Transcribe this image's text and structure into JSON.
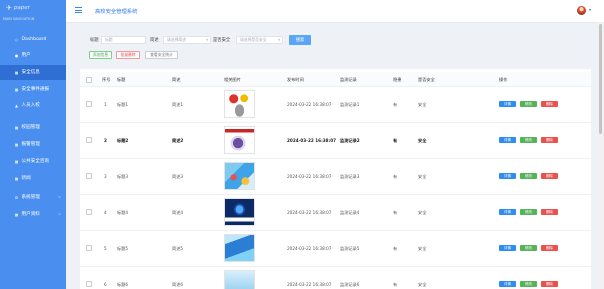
{
  "app": {
    "logo_text": "paper",
    "title": "高校安全管理系统"
  },
  "sidebar": {
    "nav_label": "MAIN NAVIGATION",
    "items": [
      {
        "label": "Dashboard",
        "icon": "dashboard-icon"
      },
      {
        "label": "用户",
        "icon": "user-icon"
      },
      {
        "label": "安全信息",
        "icon": "grid-icon",
        "active": true
      },
      {
        "label": "安全事件通报",
        "icon": "grid-icon"
      },
      {
        "label": "人员入校",
        "icon": "person-icon"
      },
      {
        "label": "校园管理",
        "icon": "grid-icon"
      },
      {
        "label": "报警管理",
        "icon": "grid-icon"
      },
      {
        "label": "公共安全咨询",
        "icon": "grid-icon"
      },
      {
        "label": "新闻",
        "icon": "grid-icon"
      },
      {
        "label": "系统管理",
        "icon": "gear-icon",
        "expandable": true
      },
      {
        "label": "用户资料",
        "icon": "grid-icon",
        "expandable": true
      }
    ]
  },
  "search": {
    "title_label": "标题",
    "title_placeholder": "标题",
    "summary_label": "简述",
    "summary_placeholder": "请选择简述",
    "safe_label": "是否安全",
    "safe_placeholder": "请选择是否安全",
    "search_button": "搜索"
  },
  "toolbar": {
    "add_label": "添加信息",
    "batch_delete_label": "批量删除",
    "stats_label": "查看安全统计"
  },
  "table": {
    "headers": {
      "index": "序号",
      "title": "标题",
      "summary": "简述",
      "image": "相关图片",
      "time": "发布时间",
      "record": "监测记录",
      "hazard": "隐患",
      "safe": "是否安全",
      "action": "操作"
    },
    "actions": {
      "detail": "详情",
      "edit": "修改",
      "delete": "删除"
    },
    "rows": [
      {
        "index": "1",
        "title": "标题1",
        "summary": "简述1",
        "time": "2024-03-22 16:38:07",
        "record": "监测记录1",
        "hazard": "有",
        "safe": "安全"
      },
      {
        "index": "2",
        "title": "标题2",
        "summary": "简述2",
        "time": "2024-03-22 16:38:07",
        "record": "监测记录2",
        "hazard": "有",
        "safe": "安全"
      },
      {
        "index": "3",
        "title": "标题3",
        "summary": "简述3",
        "time": "2024-03-22 16:38:07",
        "record": "监测记录3",
        "hazard": "有",
        "safe": "安全"
      },
      {
        "index": "4",
        "title": "标题4",
        "summary": "简述4",
        "time": "2024-03-22 16:38:07",
        "record": "监测记录4",
        "hazard": "有",
        "safe": "安全"
      },
      {
        "index": "5",
        "title": "标题5",
        "summary": "简述5",
        "time": "2024-03-22 16:38:07",
        "record": "监测记录5",
        "hazard": "有",
        "safe": "安全"
      },
      {
        "index": "6",
        "title": "标题6",
        "summary": "简述6",
        "time": "2024-03-22 16:38:07",
        "record": "监测记录6",
        "hazard": "有",
        "safe": "安全"
      }
    ]
  },
  "colors": {
    "sidebar": "#4a8ff0",
    "sidebar_active": "#2f6fd3",
    "primary": "#2f8cf0",
    "success": "#55b35a",
    "danger": "#e8524f"
  }
}
